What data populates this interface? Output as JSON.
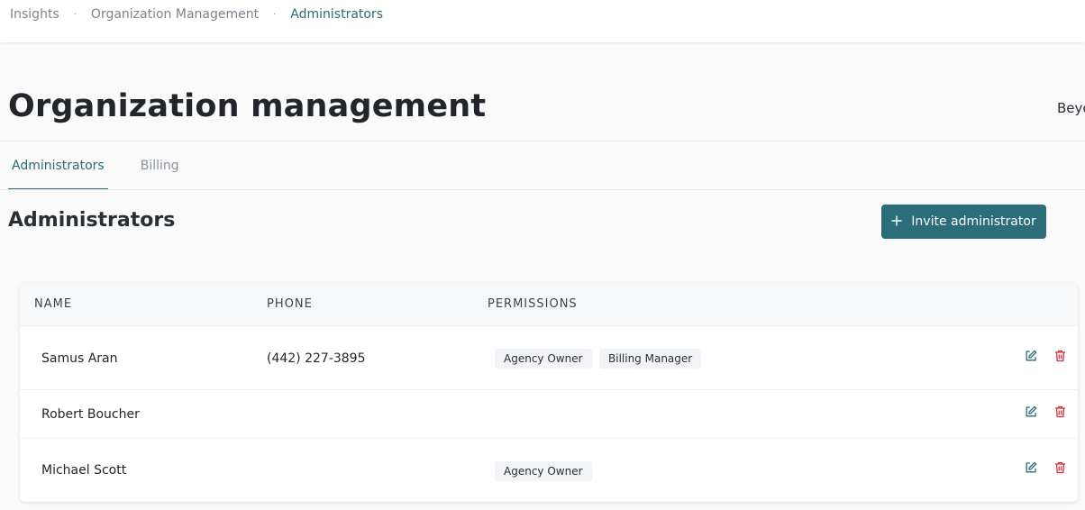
{
  "breadcrumb": {
    "items": [
      "Insights",
      "Organization Management",
      "Administrators"
    ],
    "separator": "·"
  },
  "header": {
    "title": "Organization management",
    "right_text": "Beyo"
  },
  "tabs": [
    {
      "label": "Administrators",
      "active": true
    },
    {
      "label": "Billing",
      "active": false
    }
  ],
  "section": {
    "title": "Administrators",
    "invite_button": "Invite administrator"
  },
  "table": {
    "columns": [
      "NAME",
      "PHONE",
      "PERMISSIONS"
    ],
    "rows": [
      {
        "name": "Samus Aran",
        "phone": "(442) 227-3895",
        "permissions": [
          "Agency Owner",
          "Billing Manager"
        ]
      },
      {
        "name": "Robert Boucher",
        "phone": "",
        "permissions": []
      },
      {
        "name": "Michael Scott",
        "phone": "",
        "permissions": [
          "Agency Owner"
        ]
      }
    ]
  },
  "icons": {
    "edit": "edit-icon",
    "delete": "trash-icon",
    "add": "plus-icon"
  },
  "colors": {
    "accent": "#2b6d7b",
    "delete": "#d0303f"
  }
}
